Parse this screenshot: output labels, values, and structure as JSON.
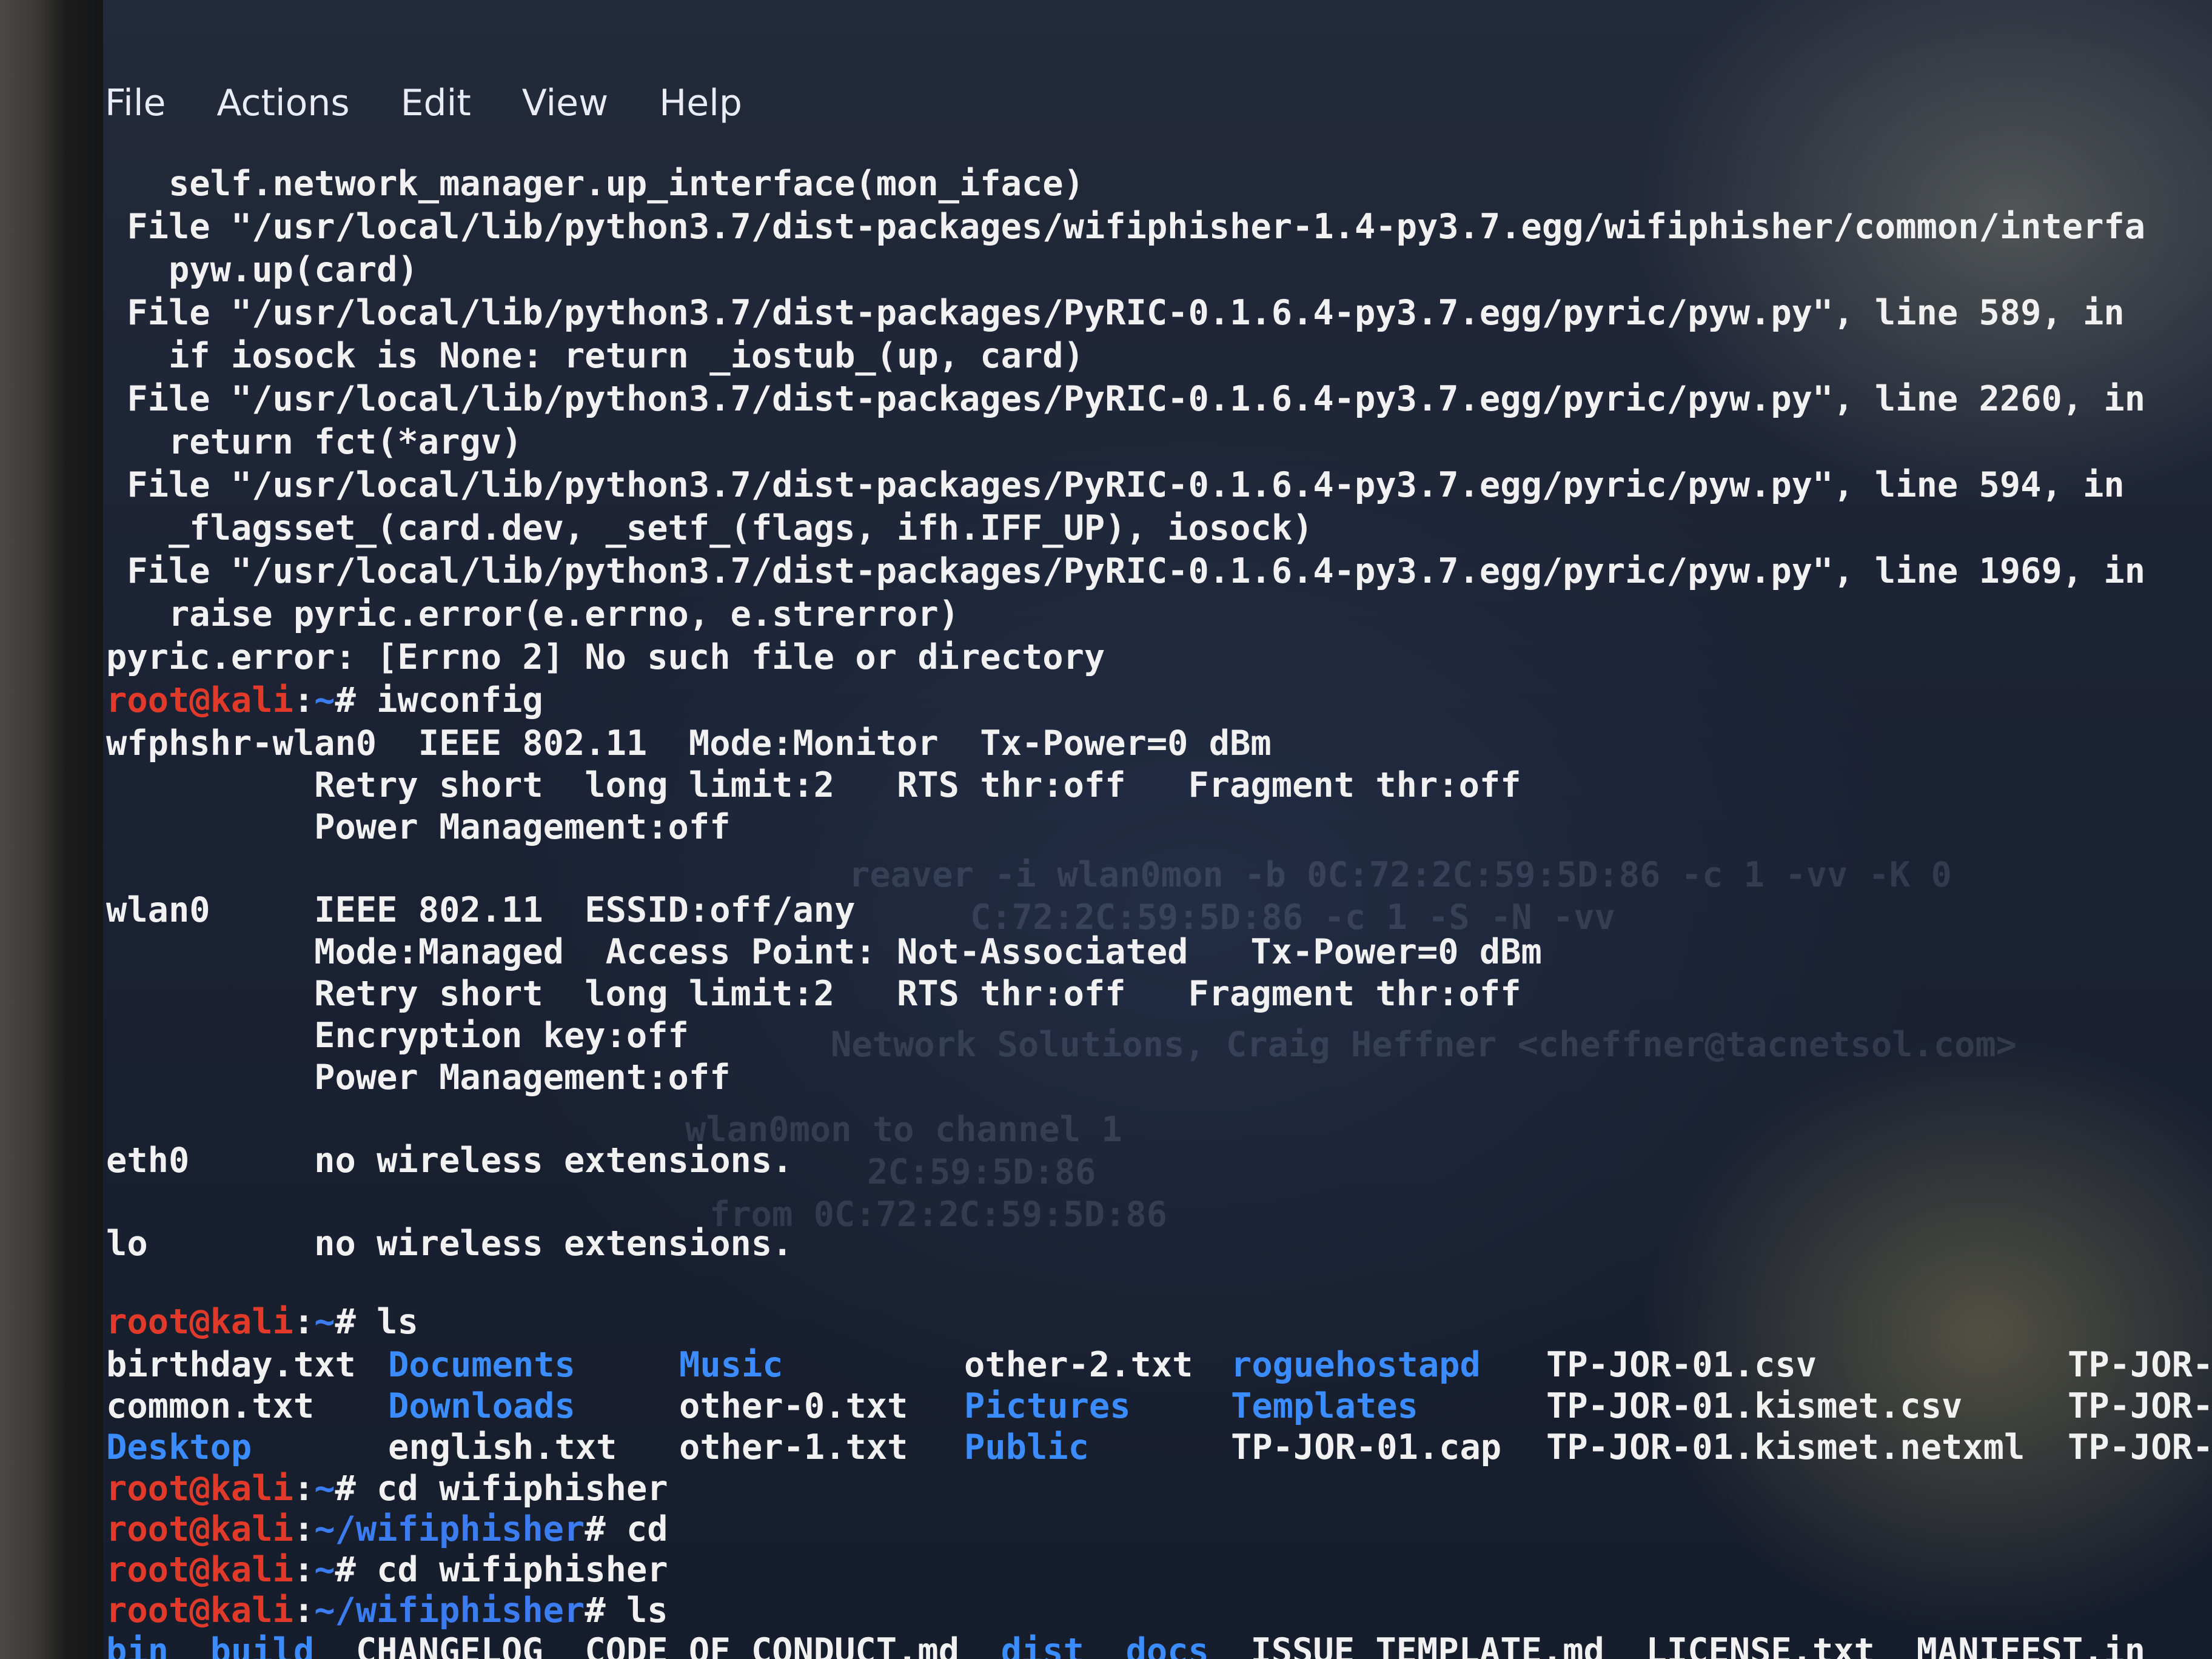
{
  "menu": {
    "items": [
      "File",
      "Actions",
      "Edit",
      "View",
      "Help"
    ]
  },
  "traceback": [
    "   self.network_manager.up_interface(mon_iface)",
    " File \"/usr/local/lib/python3.7/dist-packages/wifiphisher-1.4-py3.7.egg/wifiphisher/common/interfa",
    "   pyw.up(card)",
    " File \"/usr/local/lib/python3.7/dist-packages/PyRIC-0.1.6.4-py3.7.egg/pyric/pyw.py\", line 589, in",
    "   if iosock is None: return _iostub_(up, card)",
    " File \"/usr/local/lib/python3.7/dist-packages/PyRIC-0.1.6.4-py3.7.egg/pyric/pyw.py\", line 2260, in",
    "   return fct(*argv)",
    " File \"/usr/local/lib/python3.7/dist-packages/PyRIC-0.1.6.4-py3.7.egg/pyric/pyw.py\", line 594, in",
    "   _flagsset_(card.dev, _setf_(flags, ifh.IFF_UP), iosock)",
    " File \"/usr/local/lib/python3.7/dist-packages/PyRIC-0.1.6.4-py3.7.egg/pyric/pyw.py\", line 1969, in",
    "   raise pyric.error(e.errno, e.strerror)",
    "pyric.error: [Errno 2] No such file or directory"
  ],
  "prompt": {
    "user": "root@kali",
    "sep": ":",
    "home": "~",
    "hash": "#"
  },
  "cmd_iwconfig": "iwconfig",
  "iwconfig": [
    "wfphshr-wlan0  IEEE 802.11  Mode:Monitor  Tx-Power=0 dBm",
    "          Retry short  long limit:2   RTS thr:off   Fragment thr:off",
    "          Power Management:off",
    "",
    "wlan0     IEEE 802.11  ESSID:off/any",
    "          Mode:Managed  Access Point: Not-Associated   Tx-Power=0 dBm",
    "          Retry short  long limit:2   RTS thr:off   Fragment thr:off",
    "          Encryption key:off",
    "          Power Management:off",
    "",
    "eth0      no wireless extensions.",
    "",
    "lo        no wireless extensions."
  ],
  "cmd_ls": "ls",
  "ls_columns": [
    [
      {
        "t": "birthday.txt",
        "dir": false
      },
      {
        "t": "common.txt",
        "dir": false
      },
      {
        "t": "Desktop",
        "dir": true
      }
    ],
    [
      {
        "t": "Documents",
        "dir": true
      },
      {
        "t": "Downloads",
        "dir": true
      },
      {
        "t": "english.txt",
        "dir": false
      }
    ],
    [
      {
        "t": "Music",
        "dir": true
      },
      {
        "t": "other-0.txt",
        "dir": false
      },
      {
        "t": "other-1.txt",
        "dir": false
      }
    ],
    [
      {
        "t": "other-2.txt",
        "dir": false
      },
      {
        "t": "Pictures",
        "dir": true
      },
      {
        "t": "Public",
        "dir": true
      }
    ],
    [
      {
        "t": "roguehostapd",
        "dir": true
      },
      {
        "t": "Templates",
        "dir": true
      },
      {
        "t": "TP-JOR-01.cap",
        "dir": false
      }
    ],
    [
      {
        "t": "TP-JOR-01.csv",
        "dir": false
      },
      {
        "t": "TP-JOR-01.kismet.csv",
        "dir": false
      },
      {
        "t": "TP-JOR-01.kismet.netxml",
        "dir": false
      }
    ],
    [
      {
        "t": "TP-JOR-",
        "dir": false
      },
      {
        "t": "TP-JOR-",
        "dir": false
      },
      {
        "t": "TP-JOR-",
        "dir": false
      }
    ]
  ],
  "history": [
    {
      "path": "~",
      "cmd": "cd wifiphisher"
    },
    {
      "path": "~/wifiphisher",
      "cmd": "cd"
    },
    {
      "path": "~",
      "cmd": "cd wifiphisher"
    },
    {
      "path": "~/wifiphisher",
      "cmd": "ls"
    }
  ],
  "last_line_partial": [
    {
      "t": "bin",
      "dir": true
    },
    {
      "t": "build",
      "dir": true
    },
    {
      "t": "CHANGELOG",
      "dir": false
    },
    {
      "t": "CODE_OF_CONDUCT.md",
      "dir": false
    },
    {
      "t": "dist",
      "dir": true
    },
    {
      "t": "docs",
      "dir": true
    },
    {
      "t": "ISSUE_TEMPLATE.md",
      "dir": false
    },
    {
      "t": "LICENSE.txt",
      "dir": false
    },
    {
      "t": "MANIFEST.in",
      "dir": false
    }
  ],
  "ghost_text": [
    "reaver -i wlan0mon -b 0C:72:2C:59:5D:86 -c 1 -vv -K 0",
    "C:72:2C:59:5D:86 -c 1 -S -N -vv",
    "Network Solutions, Craig Heffner <cheffner@tacnetsol.com>",
    "wlan0mon to channel 1",
    "2C:59:5D:86",
    "from 0C:72:2C:59:5D:86"
  ],
  "colors": {
    "prompt_user": "#e23a2a",
    "prompt_path": "#3b7df0",
    "directory": "#3b8cff",
    "text": "#f1f1f1"
  }
}
